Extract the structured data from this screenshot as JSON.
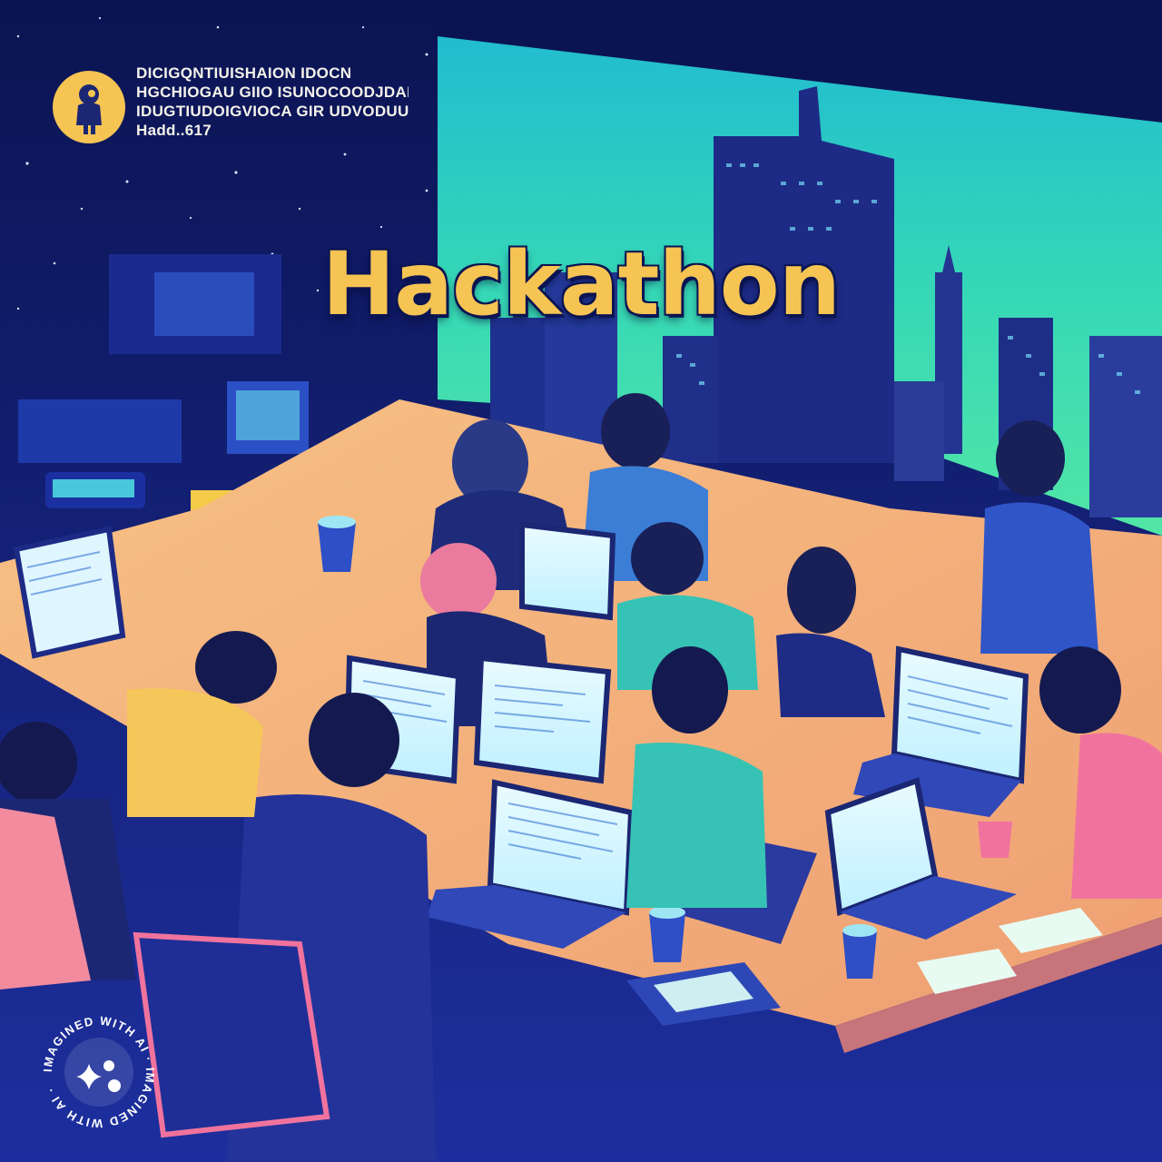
{
  "header": {
    "lines": [
      "DICIGQNTIUISHAION IDOCN",
      "HGCHIOGAU GIIO ISUNOCOODJDAMDN",
      "IDUGTIUDOIGVIOCA GIR UDVODUUGN",
      "Hadd..617"
    ]
  },
  "title": "Hackathon",
  "badge": {
    "text": "IMAGINED WITH AI · IMAGINED WITH AI · "
  },
  "colors": {
    "title": "#f6c453",
    "night_sky": "#0b1452",
    "window_sky": "#3ce0b4",
    "table": "#f4b27a",
    "logo_bg": "#f6c453"
  },
  "icons": [
    "astronaut-logo-icon",
    "sparkle-icon"
  ]
}
